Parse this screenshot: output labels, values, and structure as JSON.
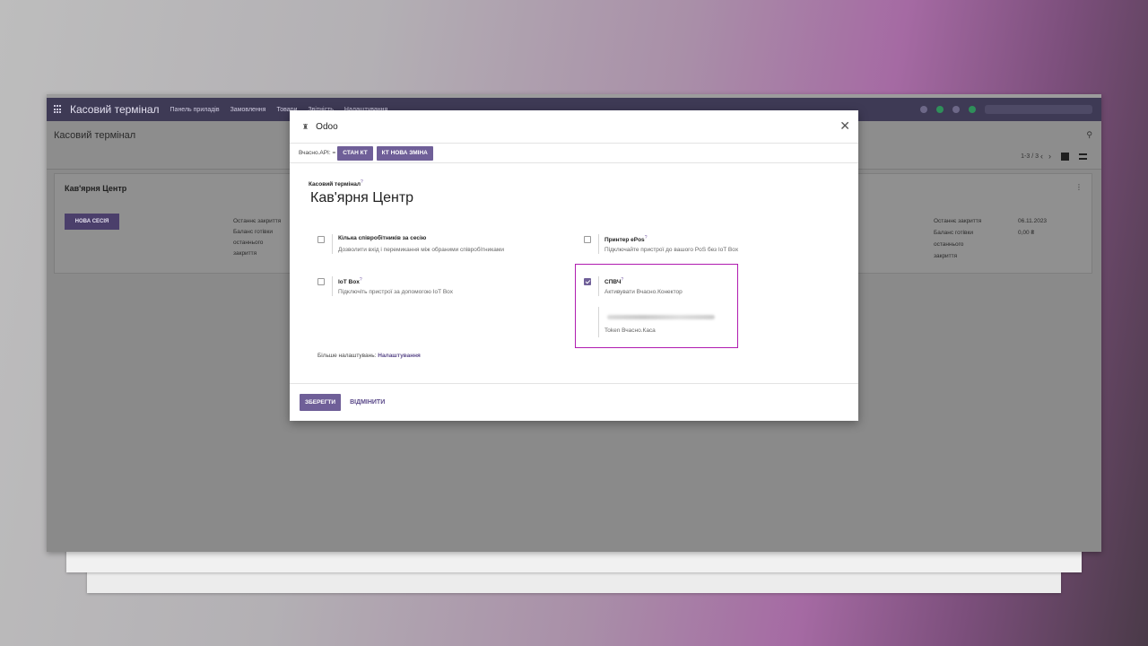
{
  "navbar": {
    "app_name": "Касовий термінал",
    "menu": [
      "Панель приладів",
      "Замовлення",
      "Товари",
      "Звітність",
      "Налаштування"
    ]
  },
  "control_panel": {
    "breadcrumb": "Касовий термінал",
    "pager": "1-3 / 3"
  },
  "kanban": {
    "card_title": "Кав'ярня Центр",
    "new_session_label": "НОВА СЕСІЯ",
    "stats_left": [
      "Останнє закриття",
      "Баланс готівки",
      "останнього",
      "закриття"
    ],
    "stats_right_labels": [
      "Останнє закриття",
      "Баланс готівки",
      "останнього",
      "закриття"
    ],
    "stats_right_values": [
      "06.11.2023",
      "0,00 ₴"
    ]
  },
  "modal": {
    "title": "Odoo",
    "api_label": "Вчасно.API: =",
    "status_buttons": [
      "СТАН КТ",
      "КТ НОВА ЗМІНА"
    ],
    "field_label": "Касовий термінал",
    "record_name": "Кав'ярня Центр",
    "options": {
      "multi_employee": {
        "title": "Кілька співробітників за сесію",
        "desc": "Дозволити вхід і перемикання між обраними співробітниками",
        "checked": false
      },
      "epos_printer": {
        "title": "Принтер ePos",
        "desc": "Підключайте пристрої до вашого PoS без IoT Box",
        "checked": false
      },
      "iot_box": {
        "title": "IoT Box",
        "desc": "Підключіть пристрої за допомогою IoT Box",
        "checked": false
      },
      "spvch": {
        "title": "СПВЧ",
        "desc": "Активувати Вчасно.Конектор",
        "checked": true,
        "token_label": "Token Вчасно.Каса"
      }
    },
    "more_settings_prefix": "Більше налаштувань:",
    "more_settings_link": "Налаштування",
    "save_label": "ЗБЕРЕГТИ",
    "cancel_label": "ВІДМІНИТИ"
  },
  "colors": {
    "accent": "#6f5f98",
    "highlight": "#b01cb0",
    "navbar": "#3e3a55"
  }
}
